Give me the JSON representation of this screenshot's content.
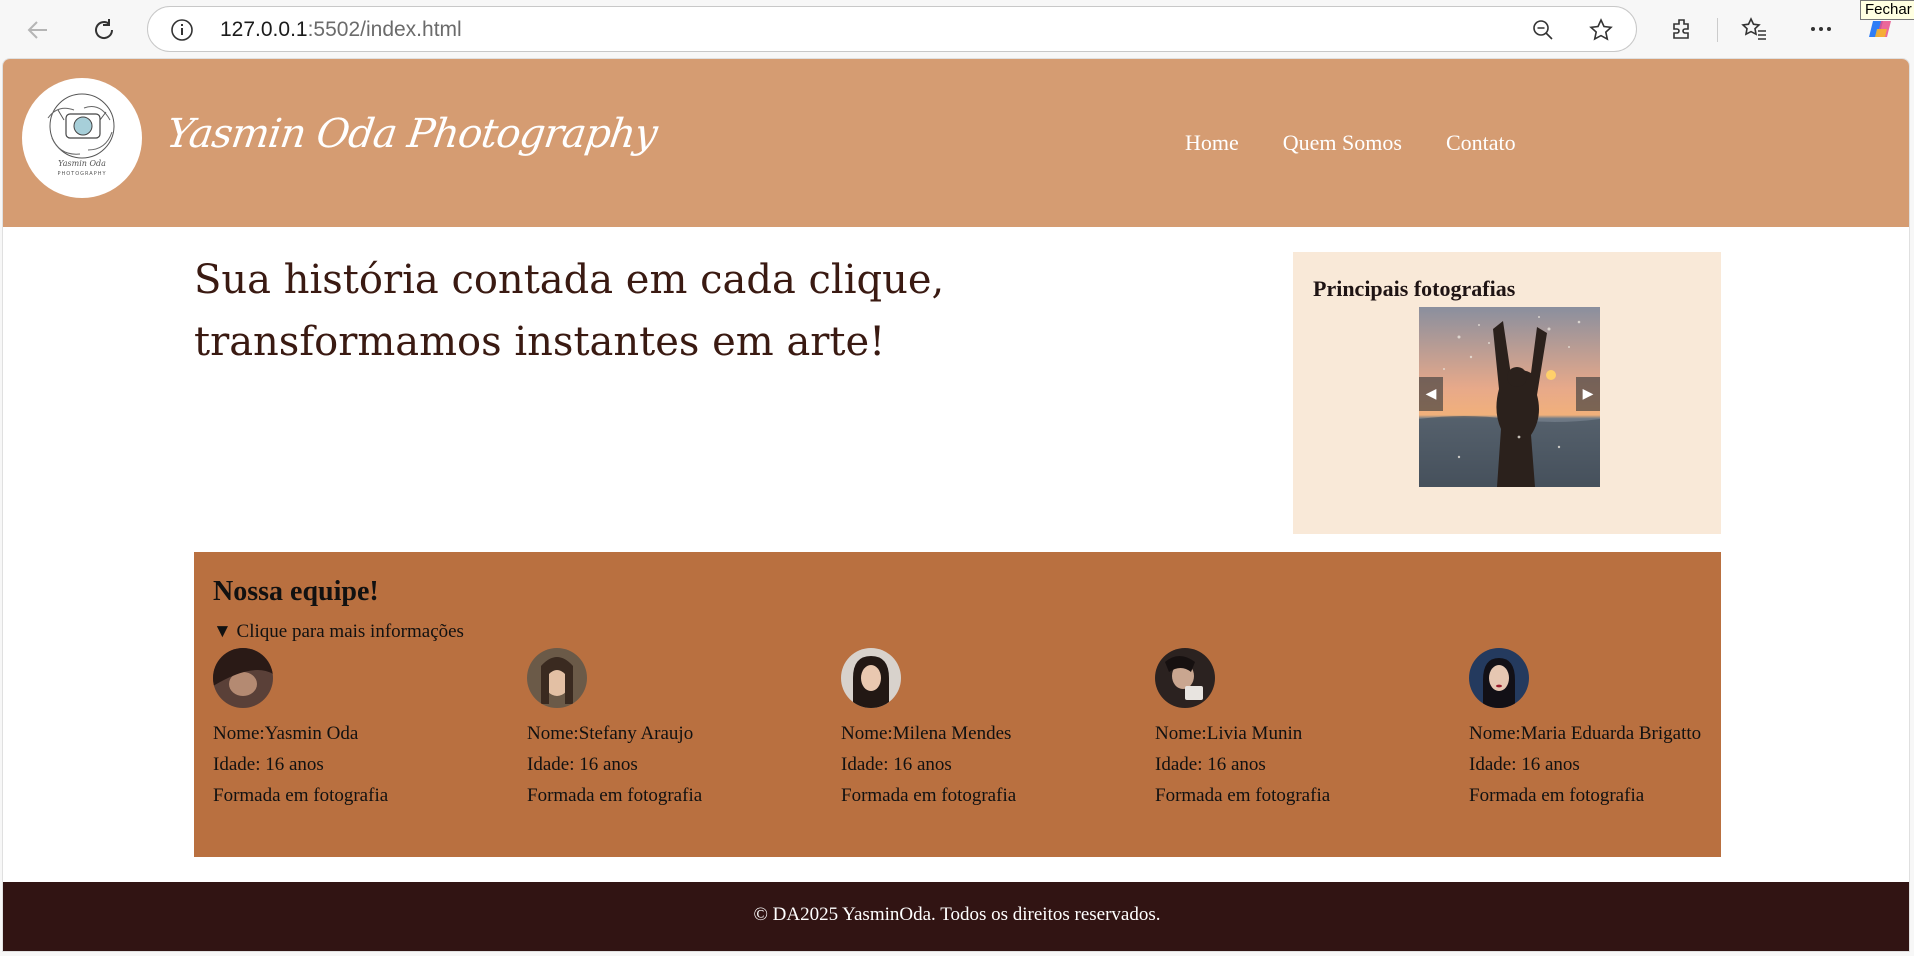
{
  "browser": {
    "url_host": "127.0.0.1",
    "url_rest": ":5502/index.html",
    "tooltip": "Fechar"
  },
  "header": {
    "brand": "Yasmin Oda Photography",
    "logo_text": "Yasmin Oda PHOTOGRAPHY",
    "nav": [
      "Home",
      "Quem Somos",
      "Contato"
    ]
  },
  "hero": {
    "line1": "Sua história contada em cada clique,",
    "line2": "transformamos instantes em arte!"
  },
  "gallery": {
    "title": "Principais fotografias",
    "prev": "◀",
    "next": "▶"
  },
  "team": {
    "title": "Nossa equipe!",
    "summary": "▼ Clique para mais informações",
    "members": [
      {
        "name": "Nome:Yasmin Oda",
        "age": "Idade: 16 anos",
        "desc": "Formada em fotografia"
      },
      {
        "name": "Nome:Stefany Araujo",
        "age": "Idade: 16 anos",
        "desc": "Formada em fotografia"
      },
      {
        "name": "Nome:Milena Mendes",
        "age": "Idade: 16 anos",
        "desc": "Formada em fotografia"
      },
      {
        "name": "Nome:Livia Munin",
        "age": "Idade: 16 anos",
        "desc": "Formada em fotografia"
      },
      {
        "name": "Nome:Maria Eduarda Brigatto",
        "age": "Idade: 16 anos",
        "desc": "Formada em fotografia"
      }
    ]
  },
  "footer": {
    "text": "© DA2025 YasminOda. Todos os direitos reservados."
  },
  "colors": {
    "header_bg": "#d59c72",
    "gallery_bg": "#f9e9d8",
    "team_bg": "#b97040",
    "footer_bg": "#311413"
  }
}
